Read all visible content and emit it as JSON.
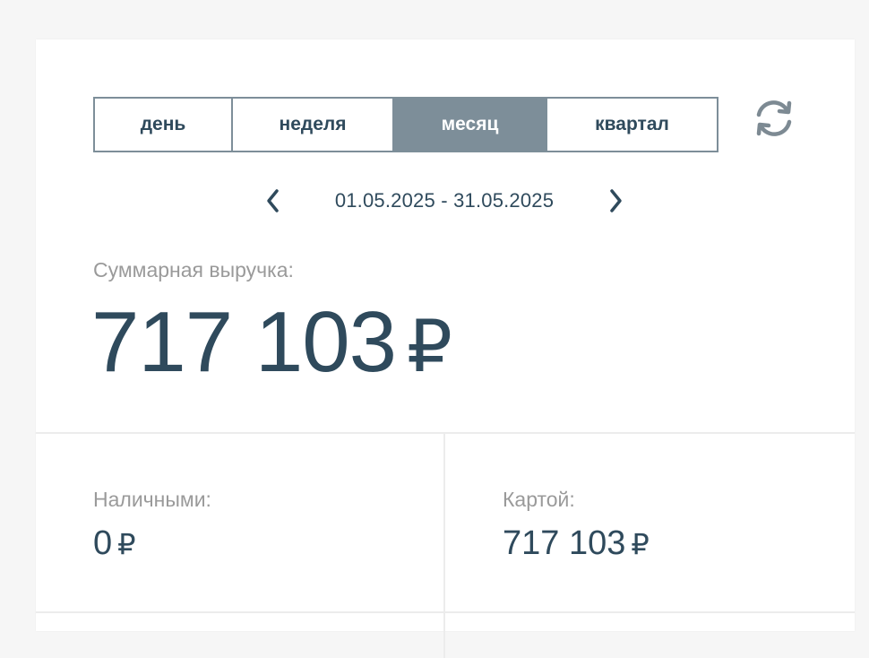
{
  "period_tabs": {
    "day": "день",
    "week": "неделя",
    "month": "месяц",
    "quarter": "квартал",
    "active": "month"
  },
  "date_nav": {
    "range": "01.05.2025 - 31.05.2025"
  },
  "total": {
    "label": "Суммарная выручка:",
    "value": "717 103",
    "currency": "₽"
  },
  "cash": {
    "label": "Наличными:",
    "value": "0",
    "currency": "₽"
  },
  "card": {
    "label": "Картой:",
    "value": "717 103",
    "currency": "₽"
  },
  "colors": {
    "accent": "#7d8e99",
    "text": "#2f4a5c",
    "muted": "#9a9a9a",
    "icon": "#7d8a93"
  },
  "icons": {
    "refresh": "refresh-icon",
    "prev": "chevron-left-icon",
    "next": "chevron-right-icon"
  }
}
